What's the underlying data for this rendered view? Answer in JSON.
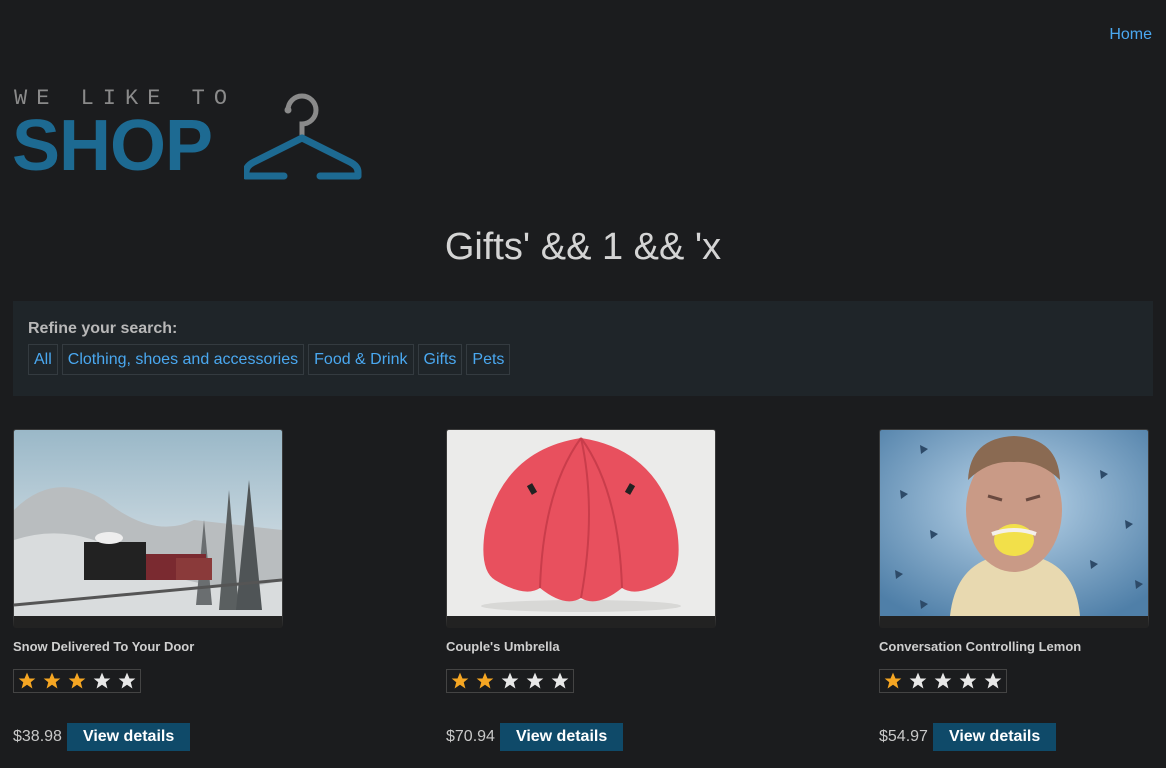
{
  "nav": {
    "home_label": "Home"
  },
  "logo": {
    "top_text": "WE LIKE TO",
    "main_text": "SHOP"
  },
  "page_title": "Gifts' && 1 && 'x",
  "filter": {
    "label": "Refine your search:",
    "links": [
      "All",
      "Clothing, shoes and accessories",
      "Food & Drink",
      "Gifts",
      "Pets"
    ]
  },
  "products": [
    {
      "name": "Snow Delivered To Your Door",
      "rating": 3,
      "price": "$38.98",
      "button": "View details"
    },
    {
      "name": "Couple's Umbrella",
      "rating": 2,
      "price": "$70.94",
      "button": "View details"
    },
    {
      "name": "Conversation Controlling Lemon",
      "rating": 1,
      "price": "$54.97",
      "button": "View details"
    }
  ],
  "colors": {
    "link": "#4aa8f0",
    "brand": "#1d6a92",
    "button": "#0f4a69",
    "star_on": "#f5a623",
    "star_off": "#e8e8e8"
  }
}
